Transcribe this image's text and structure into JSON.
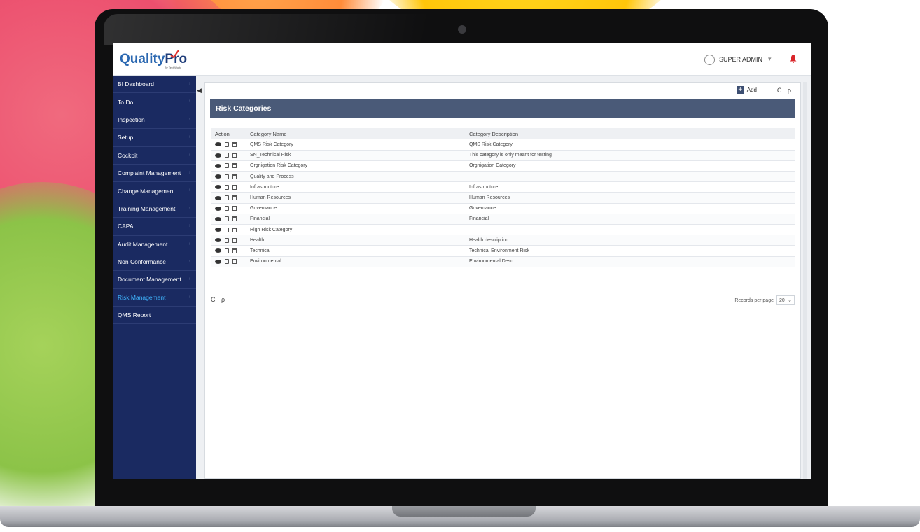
{
  "app": {
    "logo_main": "Quality",
    "logo_accent": "Pro",
    "logo_sub": "By TechWork"
  },
  "header": {
    "user_name": "SUPER ADMIN",
    "user_caret": "▾"
  },
  "sidebar": {
    "items": [
      {
        "label": "BI Dashboard"
      },
      {
        "label": "To Do"
      },
      {
        "label": "Inspection"
      },
      {
        "label": "Setup"
      },
      {
        "label": "Cockpit"
      },
      {
        "label": "Complaint Management"
      },
      {
        "label": "Change Management"
      },
      {
        "label": "Training Management"
      },
      {
        "label": "CAPA"
      },
      {
        "label": "Audit Management"
      },
      {
        "label": "Non Conformance"
      },
      {
        "label": "Document Management"
      },
      {
        "label": "Risk Management"
      },
      {
        "label": "QMS Report"
      }
    ],
    "active_label": "Risk Management"
  },
  "toolbar": {
    "add_label": "Add",
    "add_icon": "+",
    "refresh_search": "C ρ"
  },
  "page": {
    "title": "Risk Categories"
  },
  "table": {
    "headers": [
      "Action",
      "Category Name",
      "Category Description"
    ],
    "rows": [
      {
        "name": "QMS Risk Category",
        "desc": "QMS Risk Category"
      },
      {
        "name": "SN_Technical Risk",
        "desc": "This category is only meant for testing"
      },
      {
        "name": "Orgnigation Risk Category",
        "desc": "Orgnigation Category"
      },
      {
        "name": "Quality and Process",
        "desc": ""
      },
      {
        "name": "Infrastructure",
        "desc": "Infrastructure"
      },
      {
        "name": "Human Resources",
        "desc": "Human Resources"
      },
      {
        "name": "Governance",
        "desc": "Governance"
      },
      {
        "name": "Financial",
        "desc": "Financial"
      },
      {
        "name": "High Risk Category",
        "desc": ""
      },
      {
        "name": "Health",
        "desc": "Health description"
      },
      {
        "name": "Technical",
        "desc": "Technical Environment Risk"
      },
      {
        "name": "Environmental",
        "desc": "Environmental Desc"
      }
    ]
  },
  "footer": {
    "tools": "C ρ",
    "records_label": "Records per page",
    "records_value": "20",
    "records_caret": "⌄"
  },
  "colors": {
    "sidebar_bg": "#1a2a61",
    "active_nav": "#3fb6ff",
    "title_bar": "#4a5a78",
    "bell": "#d9252a"
  }
}
